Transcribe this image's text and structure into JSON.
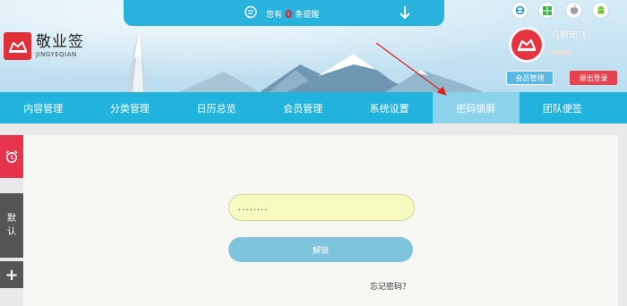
{
  "header": {
    "logo": {
      "title": "敬业签",
      "subtitle": "JINGYEQIAN"
    },
    "notice": {
      "prefix": "您有",
      "count": "0",
      "suffix": "条提醒"
    },
    "platforms": [
      "ie-icon",
      "windows-icon",
      "apple-icon",
      "android-icon"
    ],
    "user": {
      "name": "乌鹏南飞"
    },
    "buttons": {
      "member": "会员管理",
      "logout": "退出登录"
    }
  },
  "nav": {
    "items": [
      {
        "label": "内容管理"
      },
      {
        "label": "分类管理"
      },
      {
        "label": "日历总览"
      },
      {
        "label": "会员管理"
      },
      {
        "label": "系统设置"
      },
      {
        "label": "密码锁屏"
      },
      {
        "label": "团队便签"
      }
    ],
    "active_index": 5
  },
  "sidebar": {
    "default_label": [
      "默",
      "认"
    ],
    "add_label": "+"
  },
  "lock": {
    "password_value": "........",
    "unlock_label": "解锁",
    "forgot_label": "忘记密码？"
  },
  "colors": {
    "nav": "#22b3dc",
    "nav_active": "#8cd2ea",
    "accent_red": "#e5344b",
    "input_bg": "#f8fbbf",
    "unlock_btn": "#7fc4dd"
  }
}
